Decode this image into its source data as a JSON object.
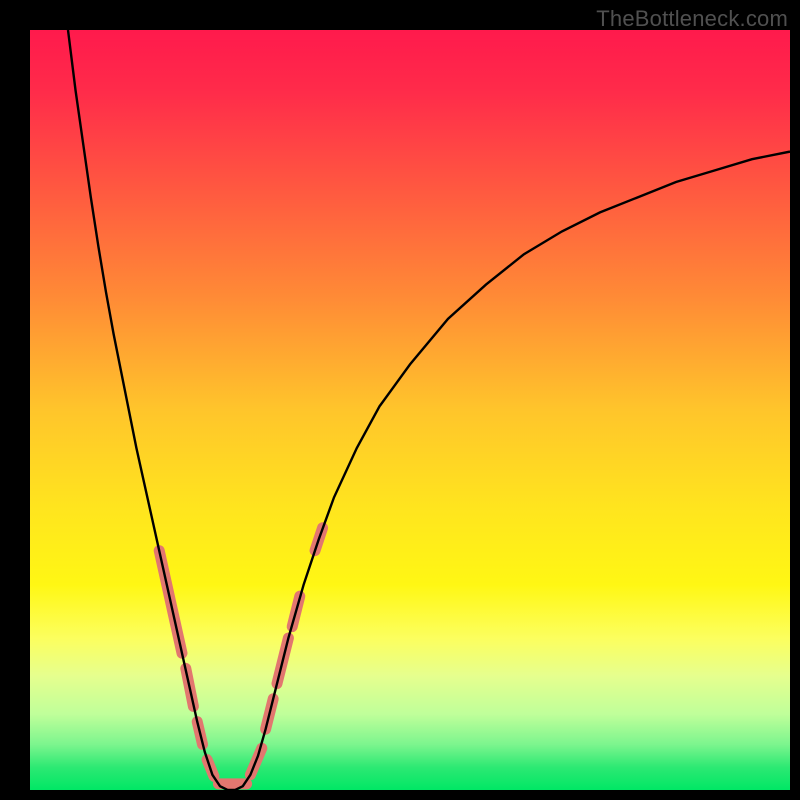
{
  "watermark": "TheBottleneck.com",
  "chart_data": {
    "type": "line",
    "title": "",
    "xlabel": "",
    "ylabel": "",
    "xlim": [
      0,
      100
    ],
    "ylim": [
      0,
      100
    ],
    "background_gradient": {
      "stops": [
        {
          "pos": 0.0,
          "color": "#ff1a4c"
        },
        {
          "pos": 0.08,
          "color": "#ff2b4a"
        },
        {
          "pos": 0.2,
          "color": "#ff5541"
        },
        {
          "pos": 0.35,
          "color": "#ff8a36"
        },
        {
          "pos": 0.5,
          "color": "#ffc52b"
        },
        {
          "pos": 0.63,
          "color": "#ffe51e"
        },
        {
          "pos": 0.73,
          "color": "#fff714"
        },
        {
          "pos": 0.8,
          "color": "#fcff5e"
        },
        {
          "pos": 0.85,
          "color": "#e6ff8e"
        },
        {
          "pos": 0.9,
          "color": "#c0ff9a"
        },
        {
          "pos": 0.94,
          "color": "#7cf58e"
        },
        {
          "pos": 0.97,
          "color": "#2de973"
        },
        {
          "pos": 1.0,
          "color": "#00e765"
        }
      ]
    },
    "series": [
      {
        "name": "bottleneck-curve",
        "stroke": "#000000",
        "stroke_width": 2.4,
        "points": [
          {
            "x": 5.0,
            "y": 100.0
          },
          {
            "x": 6.0,
            "y": 92.0
          },
          {
            "x": 7.0,
            "y": 85.0
          },
          {
            "x": 8.0,
            "y": 78.0
          },
          {
            "x": 9.0,
            "y": 71.5
          },
          {
            "x": 10.0,
            "y": 65.5
          },
          {
            "x": 11.0,
            "y": 60.0
          },
          {
            "x": 12.0,
            "y": 55.0
          },
          {
            "x": 13.0,
            "y": 50.0
          },
          {
            "x": 14.0,
            "y": 45.0
          },
          {
            "x": 15.0,
            "y": 40.5
          },
          {
            "x": 16.0,
            "y": 36.0
          },
          {
            "x": 17.0,
            "y": 31.5
          },
          {
            "x": 18.0,
            "y": 27.0
          },
          {
            "x": 19.0,
            "y": 22.5
          },
          {
            "x": 20.0,
            "y": 18.0
          },
          {
            "x": 21.0,
            "y": 13.5
          },
          {
            "x": 22.0,
            "y": 9.0
          },
          {
            "x": 23.0,
            "y": 5.0
          },
          {
            "x": 24.0,
            "y": 2.0
          },
          {
            "x": 25.0,
            "y": 0.5
          },
          {
            "x": 26.0,
            "y": 0.0
          },
          {
            "x": 27.0,
            "y": 0.0
          },
          {
            "x": 28.0,
            "y": 0.5
          },
          {
            "x": 29.0,
            "y": 2.0
          },
          {
            "x": 30.0,
            "y": 4.5
          },
          {
            "x": 31.0,
            "y": 8.0
          },
          {
            "x": 32.0,
            "y": 12.0
          },
          {
            "x": 33.0,
            "y": 16.0
          },
          {
            "x": 34.0,
            "y": 20.0
          },
          {
            "x": 36.0,
            "y": 27.0
          },
          {
            "x": 38.0,
            "y": 33.0
          },
          {
            "x": 40.0,
            "y": 38.5
          },
          {
            "x": 43.0,
            "y": 45.0
          },
          {
            "x": 46.0,
            "y": 50.5
          },
          {
            "x": 50.0,
            "y": 56.0
          },
          {
            "x": 55.0,
            "y": 62.0
          },
          {
            "x": 60.0,
            "y": 66.5
          },
          {
            "x": 65.0,
            "y": 70.5
          },
          {
            "x": 70.0,
            "y": 73.5
          },
          {
            "x": 75.0,
            "y": 76.0
          },
          {
            "x": 80.0,
            "y": 78.0
          },
          {
            "x": 85.0,
            "y": 80.0
          },
          {
            "x": 90.0,
            "y": 81.5
          },
          {
            "x": 95.0,
            "y": 83.0
          },
          {
            "x": 100.0,
            "y": 84.0
          }
        ]
      }
    ],
    "highlight_segments": {
      "stroke": "#e2776f",
      "stroke_width": 11,
      "segments": [
        {
          "from": {
            "x": 17.0,
            "y": 31.5
          },
          "to": {
            "x": 20.0,
            "y": 18.0
          }
        },
        {
          "from": {
            "x": 20.5,
            "y": 16.0
          },
          "to": {
            "x": 21.5,
            "y": 11.0
          }
        },
        {
          "from": {
            "x": 22.0,
            "y": 9.0
          },
          "to": {
            "x": 22.7,
            "y": 6.0
          }
        },
        {
          "from": {
            "x": 23.3,
            "y": 4.0
          },
          "to": {
            "x": 24.2,
            "y": 1.8
          }
        },
        {
          "from": {
            "x": 24.8,
            "y": 0.8
          },
          "to": {
            "x": 28.5,
            "y": 0.8
          }
        },
        {
          "from": {
            "x": 29.0,
            "y": 2.0
          },
          "to": {
            "x": 30.5,
            "y": 5.5
          }
        },
        {
          "from": {
            "x": 31.0,
            "y": 8.0
          },
          "to": {
            "x": 32.0,
            "y": 12.0
          }
        },
        {
          "from": {
            "x": 32.5,
            "y": 14.0
          },
          "to": {
            "x": 34.0,
            "y": 20.0
          }
        },
        {
          "from": {
            "x": 34.5,
            "y": 21.5
          },
          "to": {
            "x": 35.5,
            "y": 25.5
          }
        },
        {
          "from": {
            "x": 37.5,
            "y": 31.5
          },
          "to": {
            "x": 38.5,
            "y": 34.5
          }
        }
      ]
    }
  }
}
